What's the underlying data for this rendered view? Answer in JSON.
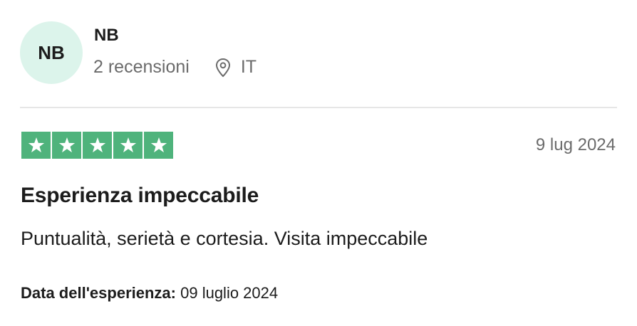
{
  "reviewer": {
    "initials": "NB",
    "name": "NB",
    "reviews_count": "2 recensioni",
    "country": "IT"
  },
  "review": {
    "rating": 5,
    "max_rating": 5,
    "date": "9 lug 2024",
    "title": "Esperienza impeccabile",
    "body": "Puntualità, serietà e cortesia. Visita impeccabile",
    "experience_label": "Data dell'esperienza:",
    "experience_date": "09 luglio 2024"
  },
  "colors": {
    "star_green": "#4fb37c",
    "avatar_bg": "#dcf4eb",
    "muted_text": "#6b6b6b"
  },
  "icons": {
    "location": "location-pin-icon",
    "star": "star-icon"
  }
}
